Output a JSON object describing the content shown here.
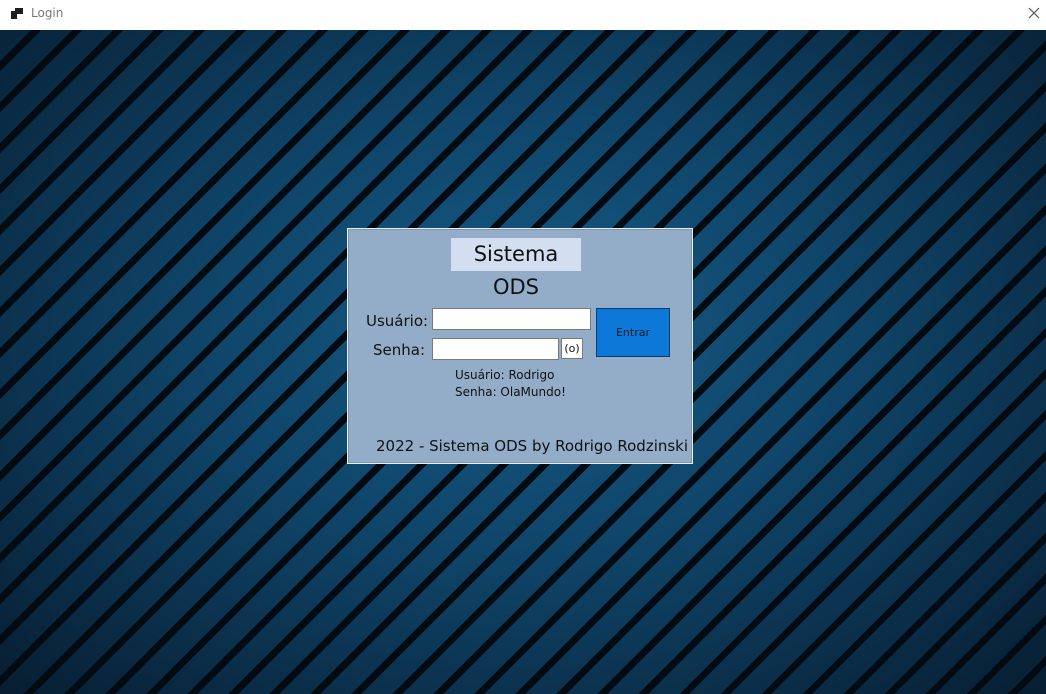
{
  "window": {
    "title": "Login",
    "app_icon": "windows-form-icon",
    "close_icon": "close-icon"
  },
  "login": {
    "title": "Sistema ODS",
    "user_label": "Usuário:",
    "password_label": "Senha:",
    "user_value": "",
    "password_value": "",
    "show_password_label": "(o)",
    "submit_label": "Entrar",
    "hint_user": "Usuário: Rodrigo",
    "hint_password": "Senha: OlaMundo!",
    "footer": "2022 - Sistema ODS by Rodrigo Rodzinski"
  },
  "colors": {
    "panel": "#93adc9",
    "title_bg": "#d3dff0",
    "button": "#0c78d8",
    "background": "#0f4468"
  }
}
